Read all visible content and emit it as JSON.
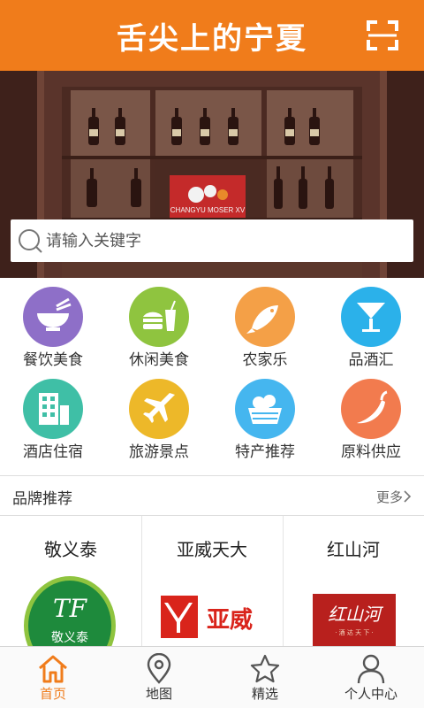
{
  "header": {
    "title": "舌尖上的宁夏",
    "scan_icon": "scan-icon"
  },
  "banner": {
    "sign_text": "CHANGYU MOSER XV"
  },
  "search": {
    "placeholder": "请输入关键字",
    "icon": "search-icon"
  },
  "categories": [
    {
      "label": "餐饮美食",
      "icon": "bowl-chopsticks-icon",
      "color": "#8e6fc8"
    },
    {
      "label": "休闲美食",
      "icon": "burger-drink-icon",
      "color": "#8fc43f"
    },
    {
      "label": "农家乐",
      "icon": "fish-icon",
      "color": "#f4a047"
    },
    {
      "label": "品酒汇",
      "icon": "cocktail-glass-icon",
      "color": "#2bb1ea"
    },
    {
      "label": "酒店住宿",
      "icon": "hotel-building-icon",
      "color": "#3fbfa6"
    },
    {
      "label": "旅游景点",
      "icon": "airplane-icon",
      "color": "#edb829"
    },
    {
      "label": "特产推荐",
      "icon": "fruit-basket-icon",
      "color": "#45b6ef"
    },
    {
      "label": "原料供应",
      "icon": "chili-pepper-icon",
      "color": "#f27b4e"
    }
  ],
  "brands": {
    "title": "品牌推荐",
    "more": "更多",
    "items": [
      {
        "name": "敬义泰",
        "logo_mark": "TF",
        "logo_text": "敬义泰"
      },
      {
        "name": "亚威天大",
        "logo_text": "亚威"
      },
      {
        "name": "红山河",
        "logo_text": "红山河",
        "logo_sub": "· 酒 达 天 下 ·"
      }
    ]
  },
  "nav": {
    "items": [
      {
        "label": "首页",
        "icon": "home-icon",
        "active": true
      },
      {
        "label": "地图",
        "icon": "map-pin-icon",
        "active": false
      },
      {
        "label": "精选",
        "icon": "star-icon",
        "active": false
      },
      {
        "label": "个人中心",
        "icon": "user-icon",
        "active": false
      }
    ]
  },
  "colors": {
    "accent": "#f07c1b",
    "header_bg": "#f07c1b"
  }
}
